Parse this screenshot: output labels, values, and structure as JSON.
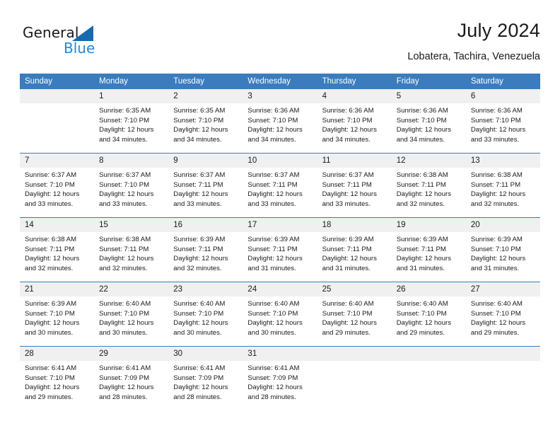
{
  "brand": {
    "name_top": "General",
    "name_bottom": "Blue",
    "accent_color": "#1769b0",
    "accent_light": "#2489d6"
  },
  "header": {
    "title": "July 2024",
    "subtitle": "Lobatera, Tachira, Venezuela"
  },
  "theme": {
    "header_bg": "#3a7cbe",
    "daynum_bg": "#f0f0f0",
    "text": "#1a1a1a"
  },
  "weekday_headers": [
    "Sunday",
    "Monday",
    "Tuesday",
    "Wednesday",
    "Thursday",
    "Friday",
    "Saturday"
  ],
  "weeks": [
    {
      "days": [
        {
          "num": "",
          "sunrise": "",
          "sunset": "",
          "daylight1": "",
          "daylight2": ""
        },
        {
          "num": "1",
          "sunrise": "Sunrise: 6:35 AM",
          "sunset": "Sunset: 7:10 PM",
          "daylight1": "Daylight: 12 hours",
          "daylight2": "and 34 minutes."
        },
        {
          "num": "2",
          "sunrise": "Sunrise: 6:35 AM",
          "sunset": "Sunset: 7:10 PM",
          "daylight1": "Daylight: 12 hours",
          "daylight2": "and 34 minutes."
        },
        {
          "num": "3",
          "sunrise": "Sunrise: 6:36 AM",
          "sunset": "Sunset: 7:10 PM",
          "daylight1": "Daylight: 12 hours",
          "daylight2": "and 34 minutes."
        },
        {
          "num": "4",
          "sunrise": "Sunrise: 6:36 AM",
          "sunset": "Sunset: 7:10 PM",
          "daylight1": "Daylight: 12 hours",
          "daylight2": "and 34 minutes."
        },
        {
          "num": "5",
          "sunrise": "Sunrise: 6:36 AM",
          "sunset": "Sunset: 7:10 PM",
          "daylight1": "Daylight: 12 hours",
          "daylight2": "and 34 minutes."
        },
        {
          "num": "6",
          "sunrise": "Sunrise: 6:36 AM",
          "sunset": "Sunset: 7:10 PM",
          "daylight1": "Daylight: 12 hours",
          "daylight2": "and 33 minutes."
        }
      ]
    },
    {
      "days": [
        {
          "num": "7",
          "sunrise": "Sunrise: 6:37 AM",
          "sunset": "Sunset: 7:10 PM",
          "daylight1": "Daylight: 12 hours",
          "daylight2": "and 33 minutes."
        },
        {
          "num": "8",
          "sunrise": "Sunrise: 6:37 AM",
          "sunset": "Sunset: 7:10 PM",
          "daylight1": "Daylight: 12 hours",
          "daylight2": "and 33 minutes."
        },
        {
          "num": "9",
          "sunrise": "Sunrise: 6:37 AM",
          "sunset": "Sunset: 7:11 PM",
          "daylight1": "Daylight: 12 hours",
          "daylight2": "and 33 minutes."
        },
        {
          "num": "10",
          "sunrise": "Sunrise: 6:37 AM",
          "sunset": "Sunset: 7:11 PM",
          "daylight1": "Daylight: 12 hours",
          "daylight2": "and 33 minutes."
        },
        {
          "num": "11",
          "sunrise": "Sunrise: 6:37 AM",
          "sunset": "Sunset: 7:11 PM",
          "daylight1": "Daylight: 12 hours",
          "daylight2": "and 33 minutes."
        },
        {
          "num": "12",
          "sunrise": "Sunrise: 6:38 AM",
          "sunset": "Sunset: 7:11 PM",
          "daylight1": "Daylight: 12 hours",
          "daylight2": "and 32 minutes."
        },
        {
          "num": "13",
          "sunrise": "Sunrise: 6:38 AM",
          "sunset": "Sunset: 7:11 PM",
          "daylight1": "Daylight: 12 hours",
          "daylight2": "and 32 minutes."
        }
      ]
    },
    {
      "days": [
        {
          "num": "14",
          "sunrise": "Sunrise: 6:38 AM",
          "sunset": "Sunset: 7:11 PM",
          "daylight1": "Daylight: 12 hours",
          "daylight2": "and 32 minutes."
        },
        {
          "num": "15",
          "sunrise": "Sunrise: 6:38 AM",
          "sunset": "Sunset: 7:11 PM",
          "daylight1": "Daylight: 12 hours",
          "daylight2": "and 32 minutes."
        },
        {
          "num": "16",
          "sunrise": "Sunrise: 6:39 AM",
          "sunset": "Sunset: 7:11 PM",
          "daylight1": "Daylight: 12 hours",
          "daylight2": "and 32 minutes."
        },
        {
          "num": "17",
          "sunrise": "Sunrise: 6:39 AM",
          "sunset": "Sunset: 7:11 PM",
          "daylight1": "Daylight: 12 hours",
          "daylight2": "and 31 minutes."
        },
        {
          "num": "18",
          "sunrise": "Sunrise: 6:39 AM",
          "sunset": "Sunset: 7:11 PM",
          "daylight1": "Daylight: 12 hours",
          "daylight2": "and 31 minutes."
        },
        {
          "num": "19",
          "sunrise": "Sunrise: 6:39 AM",
          "sunset": "Sunset: 7:11 PM",
          "daylight1": "Daylight: 12 hours",
          "daylight2": "and 31 minutes."
        },
        {
          "num": "20",
          "sunrise": "Sunrise: 6:39 AM",
          "sunset": "Sunset: 7:10 PM",
          "daylight1": "Daylight: 12 hours",
          "daylight2": "and 31 minutes."
        }
      ]
    },
    {
      "days": [
        {
          "num": "21",
          "sunrise": "Sunrise: 6:39 AM",
          "sunset": "Sunset: 7:10 PM",
          "daylight1": "Daylight: 12 hours",
          "daylight2": "and 30 minutes."
        },
        {
          "num": "22",
          "sunrise": "Sunrise: 6:40 AM",
          "sunset": "Sunset: 7:10 PM",
          "daylight1": "Daylight: 12 hours",
          "daylight2": "and 30 minutes."
        },
        {
          "num": "23",
          "sunrise": "Sunrise: 6:40 AM",
          "sunset": "Sunset: 7:10 PM",
          "daylight1": "Daylight: 12 hours",
          "daylight2": "and 30 minutes."
        },
        {
          "num": "24",
          "sunrise": "Sunrise: 6:40 AM",
          "sunset": "Sunset: 7:10 PM",
          "daylight1": "Daylight: 12 hours",
          "daylight2": "and 30 minutes."
        },
        {
          "num": "25",
          "sunrise": "Sunrise: 6:40 AM",
          "sunset": "Sunset: 7:10 PM",
          "daylight1": "Daylight: 12 hours",
          "daylight2": "and 29 minutes."
        },
        {
          "num": "26",
          "sunrise": "Sunrise: 6:40 AM",
          "sunset": "Sunset: 7:10 PM",
          "daylight1": "Daylight: 12 hours",
          "daylight2": "and 29 minutes."
        },
        {
          "num": "27",
          "sunrise": "Sunrise: 6:40 AM",
          "sunset": "Sunset: 7:10 PM",
          "daylight1": "Daylight: 12 hours",
          "daylight2": "and 29 minutes."
        }
      ]
    },
    {
      "days": [
        {
          "num": "28",
          "sunrise": "Sunrise: 6:41 AM",
          "sunset": "Sunset: 7:10 PM",
          "daylight1": "Daylight: 12 hours",
          "daylight2": "and 29 minutes."
        },
        {
          "num": "29",
          "sunrise": "Sunrise: 6:41 AM",
          "sunset": "Sunset: 7:09 PM",
          "daylight1": "Daylight: 12 hours",
          "daylight2": "and 28 minutes."
        },
        {
          "num": "30",
          "sunrise": "Sunrise: 6:41 AM",
          "sunset": "Sunset: 7:09 PM",
          "daylight1": "Daylight: 12 hours",
          "daylight2": "and 28 minutes."
        },
        {
          "num": "31",
          "sunrise": "Sunrise: 6:41 AM",
          "sunset": "Sunset: 7:09 PM",
          "daylight1": "Daylight: 12 hours",
          "daylight2": "and 28 minutes."
        },
        {
          "num": "",
          "sunrise": "",
          "sunset": "",
          "daylight1": "",
          "daylight2": ""
        },
        {
          "num": "",
          "sunrise": "",
          "sunset": "",
          "daylight1": "",
          "daylight2": ""
        },
        {
          "num": "",
          "sunrise": "",
          "sunset": "",
          "daylight1": "",
          "daylight2": ""
        }
      ]
    }
  ]
}
